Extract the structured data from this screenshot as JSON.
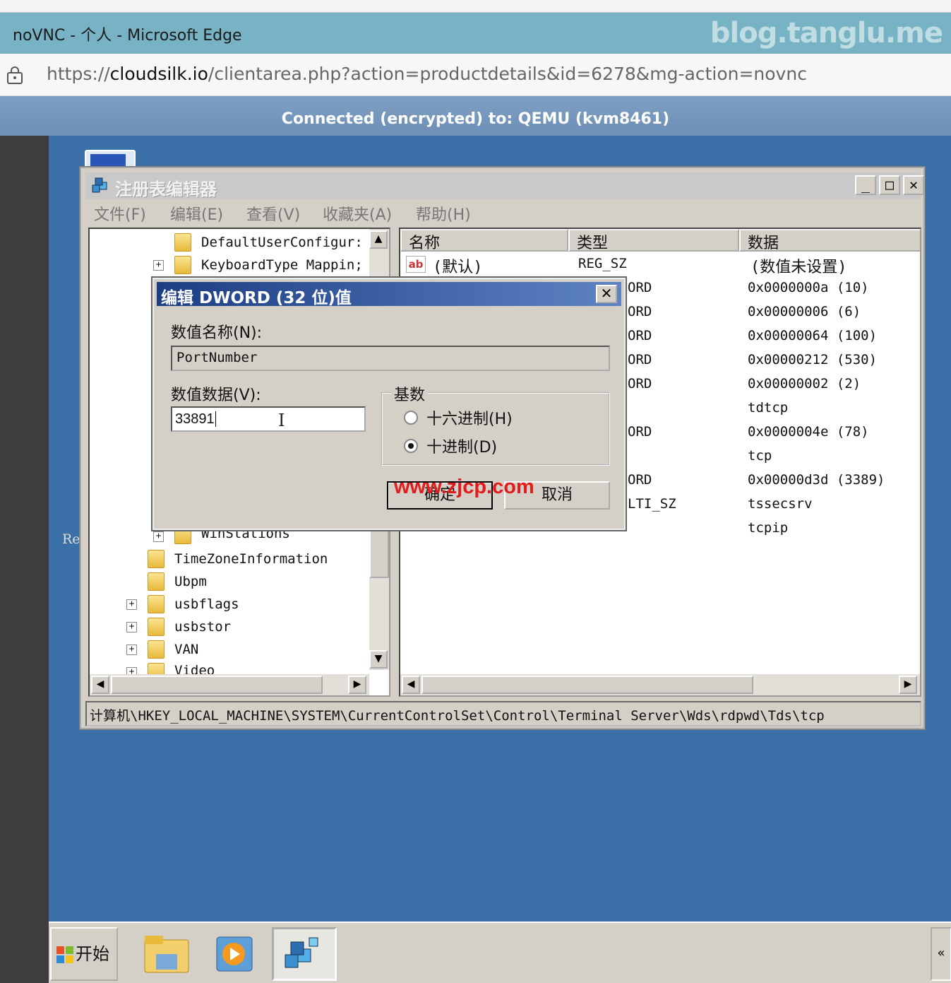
{
  "browser": {
    "title": "noVNC - 个人 - Microsoft Edge",
    "watermark": "blog.tanglu.me",
    "url_pre": "https://",
    "url_host": "cloudsilk.io",
    "url_rest": "/clientarea.php?action=productdetails&id=6278&mg-action=novnc"
  },
  "novnc": {
    "status": "Connected (encrypted) to: QEMU (kvm8461)"
  },
  "desktop": {
    "label": "Re"
  },
  "regedit": {
    "title": "注册表编辑器",
    "menu": [
      "文件(F)",
      "编辑(E)",
      "查看(V)",
      "收藏夹(A)",
      "帮助(H)"
    ],
    "tree_top": [
      {
        "label": "DefaultUserConfigur:",
        "expand": ""
      },
      {
        "label": "KeyboardType Mappin;",
        "expand": "+"
      }
    ],
    "tree_bottom": [
      {
        "label": "WinStations",
        "expand": "+"
      },
      {
        "label": "TimeZoneInformation",
        "expand": ""
      },
      {
        "label": "Ubpm",
        "expand": ""
      },
      {
        "label": "usbflags",
        "expand": "+"
      },
      {
        "label": "usbstor",
        "expand": "+"
      },
      {
        "label": "VAN",
        "expand": "+"
      },
      {
        "label": "Video",
        "expand": "+"
      }
    ],
    "columns": {
      "name": "名称",
      "type": "类型",
      "data": "数据"
    },
    "default_row": {
      "name": "(默认)",
      "type": "REG_SZ",
      "data": "(数值未设置)"
    },
    "rows": [
      {
        "type": "ORD",
        "data": "0x0000000a  (10)"
      },
      {
        "type": "ORD",
        "data": "0x00000006  (6)"
      },
      {
        "type": "ORD",
        "data": "0x00000064  (100)"
      },
      {
        "type": "ORD",
        "data": "0x00000212  (530)"
      },
      {
        "type": "ORD",
        "data": "0x00000002  (2)"
      },
      {
        "type": "",
        "data": "tdtcp"
      },
      {
        "type": "ORD",
        "data": "0x0000004e  (78)"
      },
      {
        "type": "",
        "data": "tcp"
      },
      {
        "type": "ORD",
        "data": "0x00000d3d  (3389)"
      },
      {
        "type": "LTI_SZ",
        "data": "tssecsrv"
      },
      {
        "type": "",
        "data": "tcpip"
      }
    ],
    "status_path": "计算机\\HKEY_LOCAL_MACHINE\\SYSTEM\\CurrentControlSet\\Control\\Terminal Server\\Wds\\rdpwd\\Tds\\tcp"
  },
  "dialog": {
    "title": "编辑 DWORD (32 位)值",
    "name_label": "数值名称(N):",
    "name_value": "PortNumber",
    "data_label": "数值数据(V):",
    "data_value": "33891",
    "base_label": "基数",
    "radio_hex": "十六进制(H)",
    "radio_dec": "十进制(D)",
    "selected_base": "decimal",
    "ok": "确定",
    "cancel": "取消",
    "watermark": "www.zjcp.com"
  },
  "taskbar": {
    "start": "开始",
    "tray_arrow": "«"
  }
}
